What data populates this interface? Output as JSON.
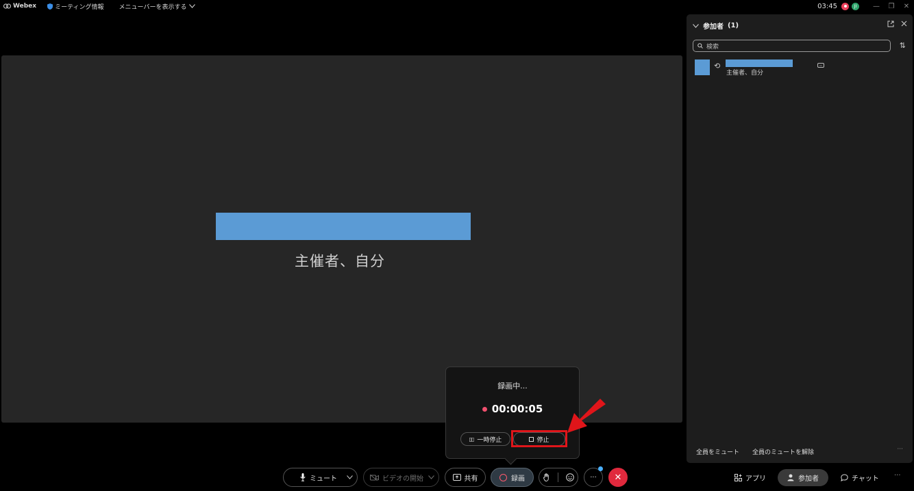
{
  "topbar": {
    "app_name": "Webex",
    "meeting_info": "ミーティング情報",
    "menu_toggle": "メニューバーを表示する",
    "time": "03:45",
    "avatar_initials": "JI"
  },
  "stage": {
    "role_label": "主催者、自分"
  },
  "recording_popover": {
    "title": "録画中...",
    "timer": "00:00:05",
    "pause_label": "一時停止",
    "stop_label": "停止"
  },
  "controls": {
    "mute_label": "ミュート",
    "video_label": "ビデオの開始",
    "share_label": "共有",
    "record_label": "録画",
    "more_label": "···"
  },
  "panel": {
    "title": "参加者",
    "count": "(1)",
    "search_placeholder": "検索",
    "participant_role": "主催者、自分",
    "mute_all": "全員をミュート",
    "unmute_all": "全員のミュートを解除",
    "more_label": "···"
  },
  "tabs": {
    "apps_label": "アプリ",
    "participants_label": "参加者",
    "chat_label": "チャット",
    "more_label": "···"
  },
  "colors": {
    "name_placeholder": "#5b9bd5",
    "record_red": "#f0506e",
    "end_call_red": "#e0293d",
    "annotation_red": "#e0151a"
  }
}
